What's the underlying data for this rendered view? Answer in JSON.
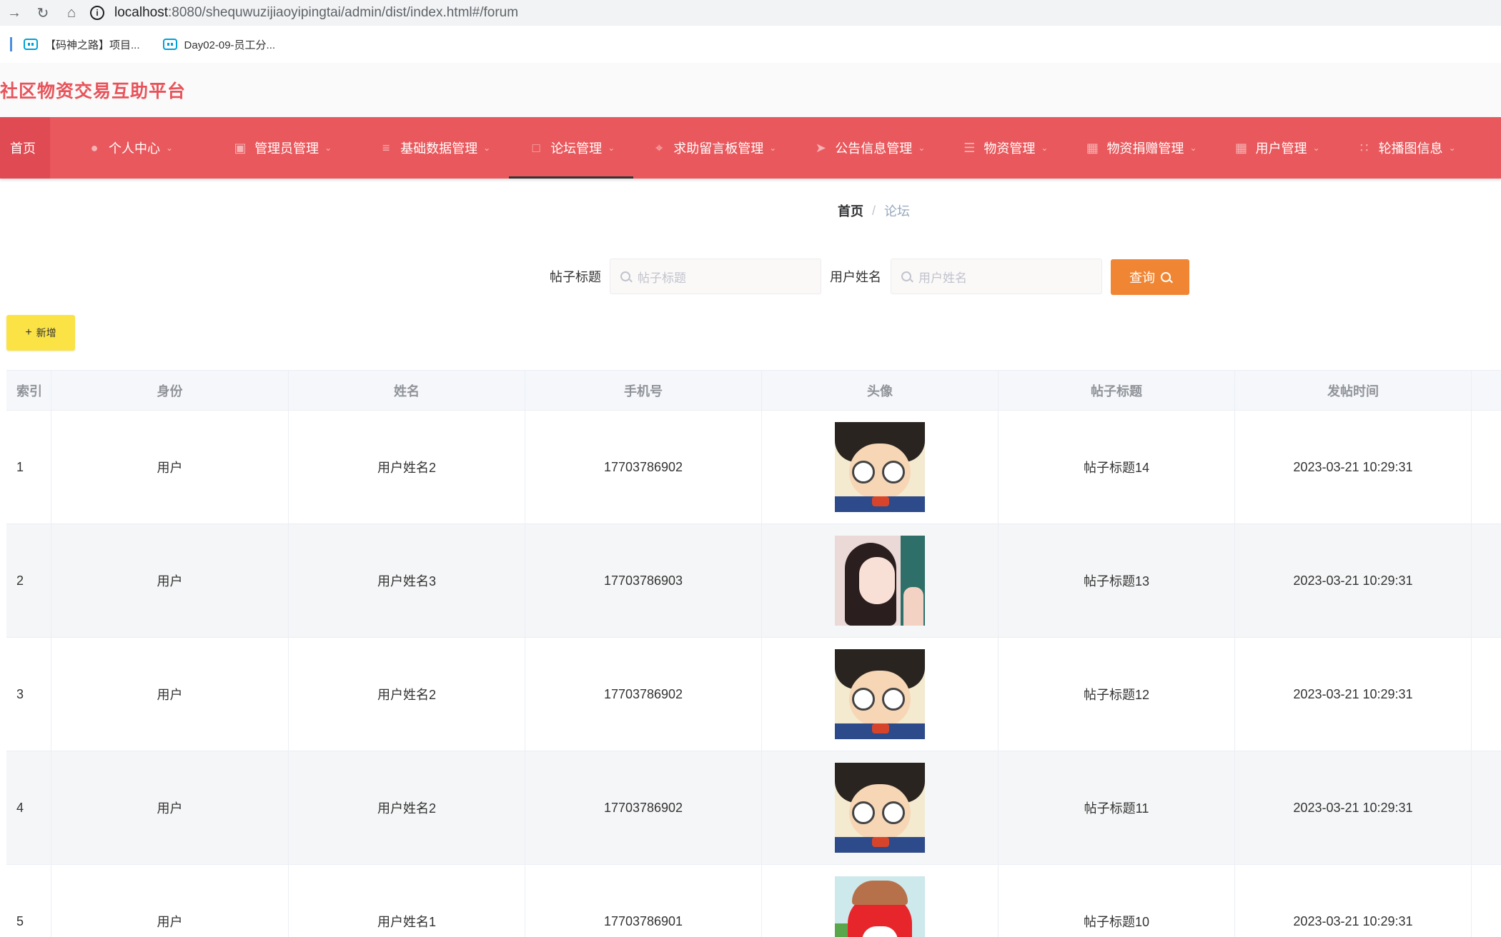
{
  "browser": {
    "url_host": "localhost",
    "url_path": ":8080/shequwuzijiaoyipingtai/admin/dist/index.html#/forum",
    "bookmarks": [
      "【码神之路】项目...",
      "Day02-09-员工分..."
    ]
  },
  "app": {
    "title": "社区物资交易互助平台"
  },
  "nav": {
    "items": [
      {
        "label": "首页",
        "icon": "home-icon"
      },
      {
        "label": "个人中心",
        "icon": "user-icon"
      },
      {
        "label": "管理员管理",
        "icon": "monitor-icon"
      },
      {
        "label": "基础数据管理",
        "icon": "sliders-icon"
      },
      {
        "label": "论坛管理",
        "icon": "chat-icon"
      },
      {
        "label": "求助留言板管理",
        "icon": "crop-icon"
      },
      {
        "label": "公告信息管理",
        "icon": "send-icon"
      },
      {
        "label": "物资管理",
        "icon": "list-icon"
      },
      {
        "label": "物资捐赠管理",
        "icon": "picture-icon"
      },
      {
        "label": "用户管理",
        "icon": "grid-icon"
      },
      {
        "label": "轮播图信息",
        "icon": "apps-icon"
      }
    ]
  },
  "breadcrumb": {
    "home": "首页",
    "sep": "/",
    "current": "论坛"
  },
  "search": {
    "title_label": "帖子标题",
    "title_placeholder": "帖子标题",
    "name_label": "用户姓名",
    "name_placeholder": "用户姓名",
    "button": "查询"
  },
  "add_button": "新增",
  "table": {
    "headers": [
      "索引",
      "身份",
      "姓名",
      "手机号",
      "头像",
      "帖子标题",
      "发帖时间"
    ],
    "rows": [
      {
        "index": "1",
        "role": "用户",
        "name": "用户姓名2",
        "phone": "17703786902",
        "avatar": "boy",
        "title": "帖子标题14",
        "time": "2023-03-21 10:29:31"
      },
      {
        "index": "2",
        "role": "用户",
        "name": "用户姓名3",
        "phone": "17703786903",
        "avatar": "girl",
        "title": "帖子标题13",
        "time": "2023-03-21 10:29:31"
      },
      {
        "index": "3",
        "role": "用户",
        "name": "用户姓名2",
        "phone": "17703786902",
        "avatar": "boy",
        "title": "帖子标题12",
        "time": "2023-03-21 10:29:31"
      },
      {
        "index": "4",
        "role": "用户",
        "name": "用户姓名2",
        "phone": "17703786902",
        "avatar": "boy",
        "title": "帖子标题11",
        "time": "2023-03-21 10:29:31"
      },
      {
        "index": "5",
        "role": "用户",
        "name": "用户姓名1",
        "phone": "17703786901",
        "avatar": "fox",
        "title": "帖子标题10",
        "time": "2023-03-21 10:29:31"
      }
    ]
  },
  "colors": {
    "nav_bg": "#e9585c",
    "title": "#e8535a",
    "search_btn": "#f08633",
    "add_btn": "#fbe346"
  }
}
